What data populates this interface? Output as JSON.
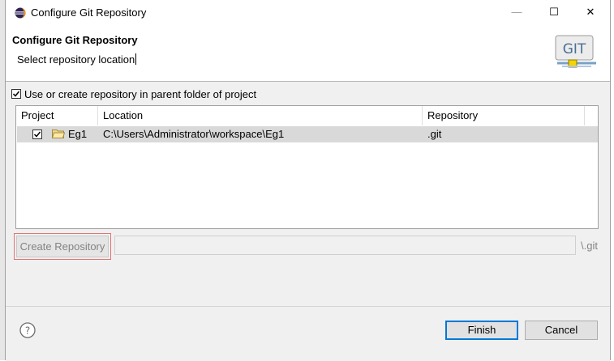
{
  "window": {
    "title": "Configure Git Repository",
    "minimize_symbol": "—",
    "maximize_symbol": "☐",
    "close_symbol": "✕"
  },
  "header": {
    "title": "Configure Git Repository",
    "message": "Select repository location",
    "logo_text": "GIT"
  },
  "options": {
    "use_parent_label": "Use or create repository in parent folder of project",
    "use_parent_checked": true
  },
  "table": {
    "columns": [
      "Project",
      "Location",
      "Repository"
    ],
    "rows": [
      {
        "checked": true,
        "project": "Eg1",
        "location": "C:\\Users\\Administrator\\workspace\\Eg1",
        "repository": ".git",
        "selected": true
      }
    ]
  },
  "create": {
    "button_label": "Create Repository",
    "path_value": "",
    "suffix": "\\.git",
    "enabled": false
  },
  "footer": {
    "finish_label": "Finish",
    "cancel_label": "Cancel"
  },
  "colors": {
    "accent": "#0078d7",
    "highlight_outline": "#e57373",
    "selection_row": "#d9d9d9"
  }
}
